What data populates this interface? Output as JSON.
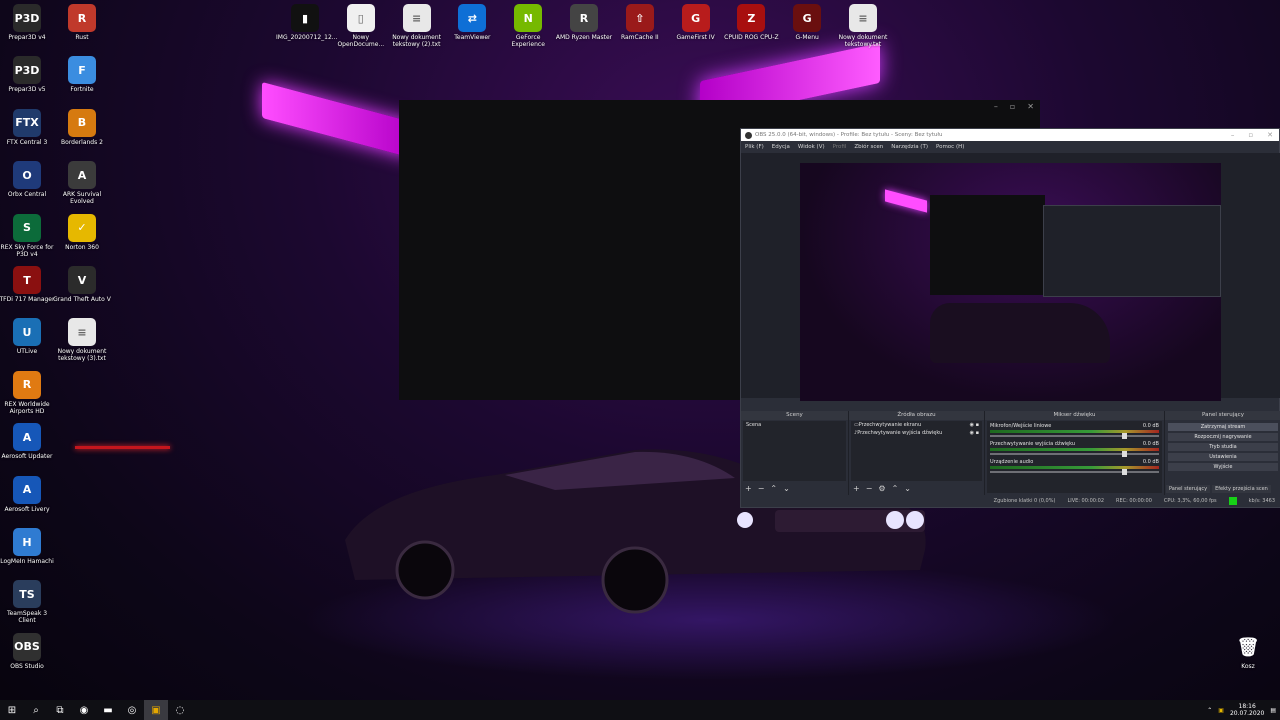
{
  "desktop": {
    "icons_left_col1": [
      {
        "label": "Prepar3D v4",
        "glyph": "P3D",
        "color": "#2a2a2a"
      },
      {
        "label": "Prepar3D v5",
        "glyph": "P3D",
        "color": "#2a2a2a"
      },
      {
        "label": "FTX Central 3",
        "glyph": "FTX",
        "color": "#203a6b"
      },
      {
        "label": "Orbx Central",
        "glyph": "O",
        "color": "#1f3a7a"
      },
      {
        "label": "REX Sky Force for P3D v4",
        "glyph": "S",
        "color": "#0c6b3a"
      },
      {
        "label": "TFDi 717 Manager",
        "glyph": "T",
        "color": "#8a1010"
      },
      {
        "label": "UTLive",
        "glyph": "U",
        "color": "#1a6fb5"
      },
      {
        "label": "REX Worldwide Airports HD",
        "glyph": "R",
        "color": "#e07a12"
      },
      {
        "label": "Aerosoft Updater",
        "glyph": "A",
        "color": "#1657b8"
      },
      {
        "label": "Aerosoft Livery",
        "glyph": "A",
        "color": "#1657b8"
      },
      {
        "label": "LogMeIn Hamachi",
        "glyph": "H",
        "color": "#2f7bd1"
      },
      {
        "label": "TeamSpeak 3 Client",
        "glyph": "TS",
        "color": "#2a3d5c"
      },
      {
        "label": "OBS Studio",
        "glyph": "OBS",
        "color": "#303030"
      }
    ],
    "icons_left_col2": [
      {
        "label": "Rust",
        "glyph": "R",
        "color": "#c0392b"
      },
      {
        "label": "Fortnite",
        "glyph": "F",
        "color": "#3b8de0"
      },
      {
        "label": "Borderlands 2",
        "glyph": "B",
        "color": "#d67a10"
      },
      {
        "label": "ARK Survival Evolved",
        "glyph": "A",
        "color": "#3b3b3b"
      },
      {
        "label": "Norton 360",
        "glyph": "✓",
        "color": "#e6b800"
      },
      {
        "label": "Grand Theft Auto V",
        "glyph": "V",
        "color": "#2b2b2b"
      },
      {
        "label": "Nowy dokument tekstowy (3).txt",
        "glyph": "≡",
        "color": "#e8e8e8"
      }
    ],
    "icons_top_row": [
      {
        "label": "IMG_20200712_12...",
        "glyph": "▮",
        "color": "#111111"
      },
      {
        "label": "Nowy OpenDocume...",
        "glyph": "▯",
        "color": "#f0f0f0"
      },
      {
        "label": "Nowy dokument tekstowy (2).txt",
        "glyph": "≡",
        "color": "#e8e8e8"
      },
      {
        "label": "TeamViewer",
        "glyph": "⇄",
        "color": "#0e6fd6"
      },
      {
        "label": "GeForce Experience",
        "glyph": "N",
        "color": "#76b900"
      },
      {
        "label": "AMD Ryzen Master",
        "glyph": "R",
        "color": "#444444"
      },
      {
        "label": "RamCache II",
        "glyph": "⇧",
        "color": "#9a1a1a"
      },
      {
        "label": "GameFirst IV",
        "glyph": "G",
        "color": "#b81c1c"
      },
      {
        "label": "CPUID ROG CPU-Z",
        "glyph": "Z",
        "color": "#a80f0f"
      },
      {
        "label": "G-Menu",
        "glyph": "G",
        "color": "#6a0f0f"
      },
      {
        "label": "Nowy dokument tekstowy.txt",
        "glyph": "≡",
        "color": "#e8e8e8"
      }
    ],
    "recycle_bin": {
      "label": "Kosz",
      "glyph": "🗑"
    }
  },
  "obs": {
    "title": "OBS 25.0.0 (64-bit, windows) - Profile: Bez tytułu - Sceny: Bez tytułu",
    "menu": [
      "Plik (F)",
      "Edycja",
      "Widok (V)",
      "Profil",
      "Zbiór scen",
      "Narzędzia (T)",
      "Pomoc (H)"
    ],
    "panels": {
      "scenes": {
        "header": "Sceny",
        "items": [
          "Scena"
        ]
      },
      "sources": {
        "header": "Źródła obrazu",
        "items": [
          "Przechwytywanie ekranu",
          "Przechwytywanie wyjścia dźwięku"
        ]
      },
      "mixer": {
        "header": "Mikser dźwięku",
        "rows": [
          {
            "name": "Mikrofon/Wejście liniowe",
            "db": "0.0 dB"
          },
          {
            "name": "Przechwytywanie wyjścia dźwięku",
            "db": "0.0 dB"
          },
          {
            "name": "Urządzenie audio",
            "db": "0.0 dB"
          }
        ]
      },
      "controls": {
        "header": "Panel sterujący",
        "buttons": [
          "Zatrzymaj stream",
          "Rozpocznij nagrywanie",
          "Tryb studia",
          "Ustawienia",
          "Wyjście"
        ]
      }
    },
    "dock_tabs": [
      "Panel sterujący",
      "Efekty przejścia scen"
    ],
    "status": {
      "dropped": "Zgubione klatki 0 (0,0%)",
      "live": "LIVE: 00:00:02",
      "rec": "REC: 00:00:00",
      "cpu": "CPU: 3,3%, 60,00 fps",
      "kbps": "kb/s: 3463"
    }
  },
  "taskbar": {
    "buttons": [
      "⊞",
      "⌕",
      "⧉",
      "◉",
      "▬",
      "◎",
      "▣",
      "◌"
    ],
    "time": "18:16",
    "date": "20.07.2020"
  }
}
